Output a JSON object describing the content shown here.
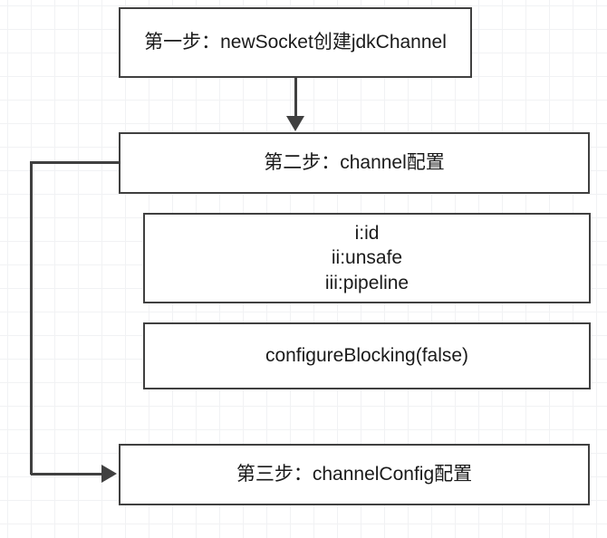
{
  "boxes": {
    "step1": "第一步：newSocket创建jdkChannel",
    "step2": "第二步：channel配置",
    "detail": "i:id\nii:unsafe\niii:pipeline",
    "config": "configureBlocking(false)",
    "step3": "第三步：channelConfig配置"
  }
}
